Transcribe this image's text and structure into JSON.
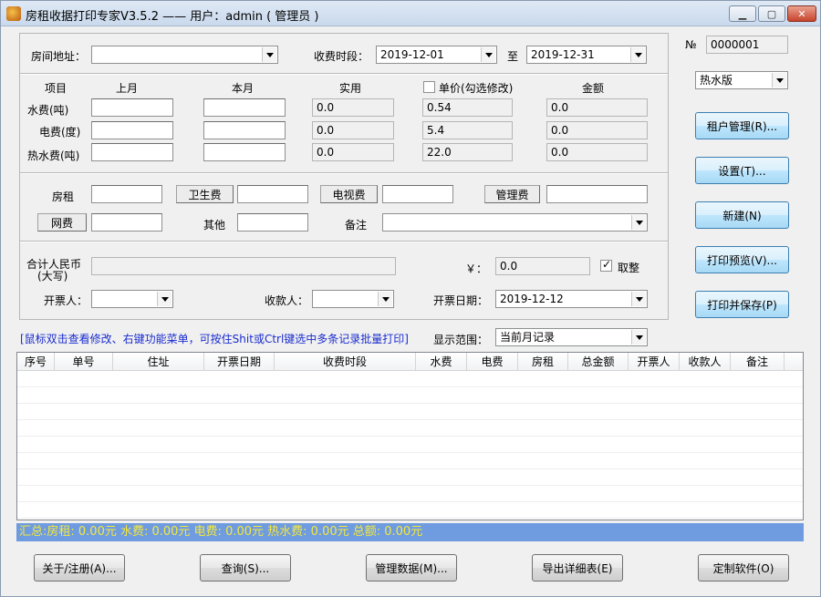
{
  "window": {
    "title": "房租收据打印专家V3.5.2 —— 用户：admin ( 管理员 )",
    "min_symbol": "▁",
    "max_symbol": "▢",
    "close_symbol": "✕"
  },
  "top": {
    "address_label": "房间地址：",
    "address_value": "",
    "period_label": "收费时段：",
    "period_from": "2019-12-01",
    "period_to_label": "至",
    "period_to": "2019-12-31"
  },
  "utilities": {
    "headers": {
      "item": "项目",
      "last_month": "上月",
      "this_month": "本月",
      "actual": "实用",
      "unit_price": "单价(勾选修改)",
      "amount": "金额"
    },
    "unit_price_checked": false,
    "rows": [
      {
        "label": "水费(吨)",
        "last": "",
        "current": "",
        "actual": "0.0",
        "price": "0.54",
        "amount": "0.0"
      },
      {
        "label": "电费(度)",
        "last": "",
        "current": "",
        "actual": "0.0",
        "price": "5.4",
        "amount": "0.0"
      },
      {
        "label": "热水费(吨)",
        "last": "",
        "current": "",
        "actual": "0.0",
        "price": "22.0",
        "amount": "0.0"
      }
    ]
  },
  "fees": {
    "rent_label": "房租",
    "rent_value": "",
    "sanitation_label": "卫生费",
    "sanitation_value": "",
    "tv_label": "电视费",
    "tv_value": "",
    "management_label": "管理费",
    "management_value": "",
    "network_label": "网费",
    "network_value": "",
    "other_label": "其他",
    "other_value": "",
    "remark_label": "备注",
    "remark_value": ""
  },
  "totals": {
    "rmb_label_line1": "合计人民币",
    "rmb_label_line2": "(大写)",
    "rmb_uppercase": "",
    "yuan_symbol": "￥：",
    "yuan_value": "0.0",
    "round_label": "取整",
    "round_checked": true,
    "issuer_label": "开票人：",
    "issuer_value": "",
    "payee_label": "收款人：",
    "payee_value": "",
    "date_label": "开票日期：",
    "date_value": "2019-12-12"
  },
  "side": {
    "no_label": "№",
    "no_value": "0000001",
    "template_value": "热水版",
    "buttons": [
      "租户管理(R)...",
      "设置(T)...",
      "新建(N)",
      "打印预览(V)...",
      "打印并保存(P)"
    ]
  },
  "list": {
    "hint": "[鼠标双击查看修改、右键功能菜单，可按住Shit或Ctrl键选中多条记录批量打印]",
    "range_label": "显示范围：",
    "range_value": "当前月记录",
    "columns": [
      "序号",
      "单号",
      "住址",
      "开票日期",
      "收费时段",
      "水费",
      "电费",
      "房租",
      "总金额",
      "开票人",
      "收款人",
      "备注"
    ],
    "rows": []
  },
  "summary": {
    "text": "汇总:房租: 0.00元  水费: 0.00元  电费: 0.00元  热水费: 0.00元  总额: 0.00元"
  },
  "bottom_buttons": [
    "关于/注册(A)...",
    "查询(S)...",
    "管理数据(M)...",
    "导出详细表(E)",
    "定制软件(O)"
  ]
}
